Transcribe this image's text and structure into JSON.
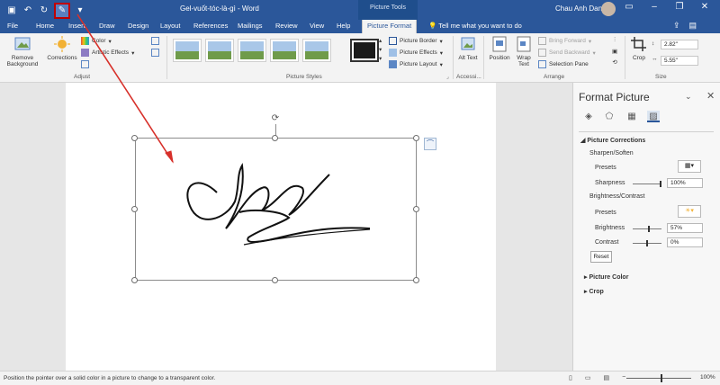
{
  "titlebar": {
    "doc_title": "Gel-vuốt-tóc-là-gì - Word",
    "context_title": "Picture Tools",
    "user_name": "Chau Anh Dang"
  },
  "tabs": [
    "File",
    "Home",
    "Insert",
    "Draw",
    "Design",
    "Layout",
    "References",
    "Mailings",
    "Review",
    "View",
    "Help",
    "Picture Format"
  ],
  "tell_me": "Tell me what you want to do",
  "ribbon": {
    "remove_bg_label": "Remove Background",
    "corrections_label": "Corrections",
    "color_label": "Color",
    "artistic_label": "Artistic Effects",
    "adjust_group": "Adjust",
    "styles_group": "Picture Styles",
    "border_label": "Picture Border",
    "effects_label": "Picture Effects",
    "layout_label": "Picture Layout",
    "alt_text_label": "Alt Text",
    "access_group": "Accessi...",
    "position_label": "Position",
    "wrap_label": "Wrap Text",
    "bring_fwd_label": "Bring Forward",
    "send_back_label": "Send Backward",
    "sel_pane_label": "Selection Pane",
    "arrange_group": "Arrange",
    "crop_label": "Crop",
    "height_value": "2.82\"",
    "width_value": "5.55\"",
    "size_group": "Size"
  },
  "panel": {
    "title": "Format Picture",
    "section_corrections": "Picture Corrections",
    "sharpen_soften": "Sharpen/Soften",
    "presets1": "Presets",
    "sharpness_label": "Sharpness",
    "sharpness_value": "100%",
    "sharpness_level": 1.0,
    "brightness_contrast": "Brightness/Contrast",
    "presets2": "Presets",
    "brightness_label": "Brightness",
    "brightness_value": "57%",
    "brightness_level": 0.57,
    "contrast_label": "Contrast",
    "contrast_value": "0%",
    "contrast_level": 0.5,
    "reset_label": "Reset",
    "section_color": "Picture Color",
    "section_crop": "Crop"
  },
  "status_text": "Position the pointer over a solid color in a picture to change to a transparent color.",
  "zoom_value": "100%",
  "colors": {
    "accent": "#2b579a",
    "highlight": "#c00000"
  }
}
